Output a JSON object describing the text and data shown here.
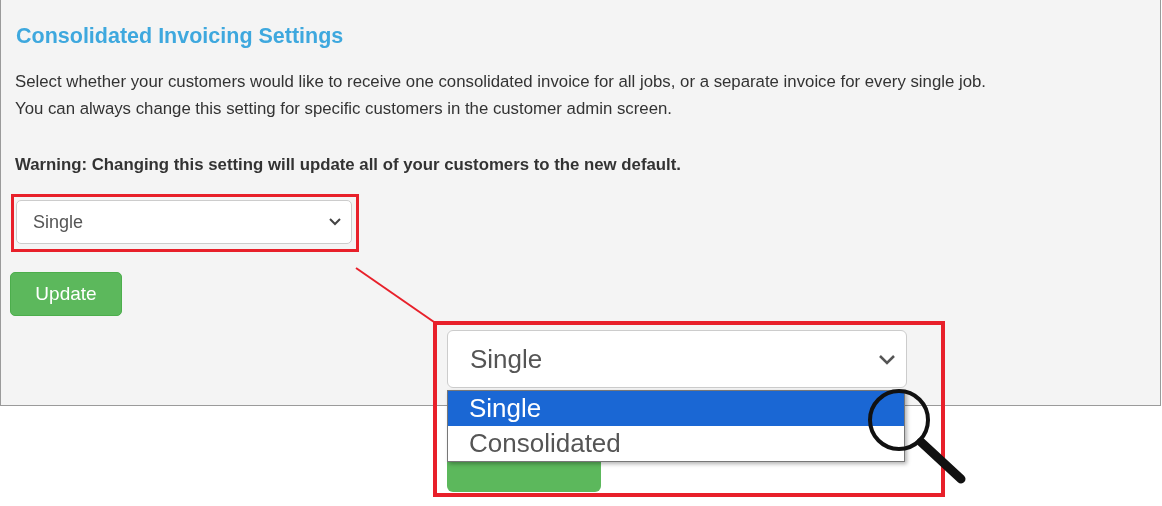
{
  "panel": {
    "title": "Consolidated Invoicing Settings",
    "description": [
      "Select whether your customers would like to receive one consolidated invoice for all jobs, or a separate invoice for every single job.",
      "You can always change this setting for specific customers in the customer admin screen."
    ],
    "warning": "Warning: Changing this setting will update all of your customers to the new default."
  },
  "select": {
    "value": "Single"
  },
  "update_button": "Update",
  "zoom_callout": {
    "select_value": "Single",
    "options": [
      {
        "label": "Single",
        "selected": true
      },
      {
        "label": "Consolidated",
        "selected": false
      }
    ]
  }
}
